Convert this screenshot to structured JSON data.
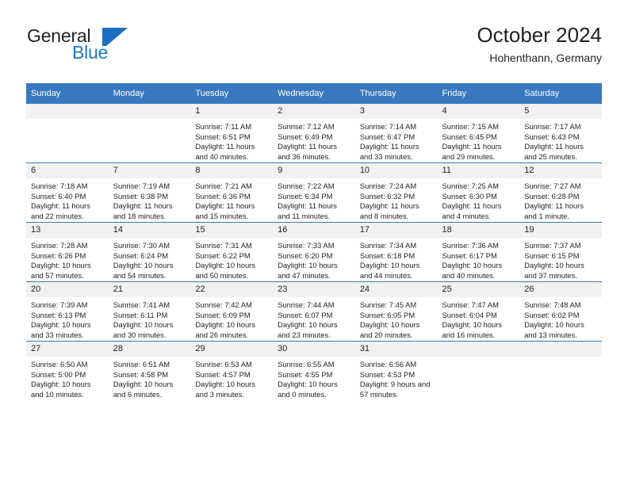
{
  "logo": {
    "text_primary": "General",
    "text_secondary": "Blue",
    "icon": "flag-triangle-icon",
    "color_primary": "#231f20",
    "color_secondary": "#1f77c2"
  },
  "header": {
    "title": "October 2024",
    "subtitle": "Hohenthann, Germany"
  },
  "colors": {
    "header_row_bg": "#3978bf",
    "daynum_bg": "#f1f1f1",
    "grid_line": "#3978bf",
    "text": "#231f20"
  },
  "weekday_headers": [
    "Sunday",
    "Monday",
    "Tuesday",
    "Wednesday",
    "Thursday",
    "Friday",
    "Saturday"
  ],
  "weeks": [
    [
      {
        "day": "",
        "empty": true
      },
      {
        "day": "",
        "empty": true
      },
      {
        "day": "1",
        "sunrise": "Sunrise: 7:11 AM",
        "sunset": "Sunset: 6:51 PM",
        "daylight": "Daylight: 11 hours and 40 minutes."
      },
      {
        "day": "2",
        "sunrise": "Sunrise: 7:12 AM",
        "sunset": "Sunset: 6:49 PM",
        "daylight": "Daylight: 11 hours and 36 minutes."
      },
      {
        "day": "3",
        "sunrise": "Sunrise: 7:14 AM",
        "sunset": "Sunset: 6:47 PM",
        "daylight": "Daylight: 11 hours and 33 minutes."
      },
      {
        "day": "4",
        "sunrise": "Sunrise: 7:15 AM",
        "sunset": "Sunset: 6:45 PM",
        "daylight": "Daylight: 11 hours and 29 minutes."
      },
      {
        "day": "5",
        "sunrise": "Sunrise: 7:17 AM",
        "sunset": "Sunset: 6:43 PM",
        "daylight": "Daylight: 11 hours and 25 minutes."
      }
    ],
    [
      {
        "day": "6",
        "sunrise": "Sunrise: 7:18 AM",
        "sunset": "Sunset: 6:40 PM",
        "daylight": "Daylight: 11 hours and 22 minutes."
      },
      {
        "day": "7",
        "sunrise": "Sunrise: 7:19 AM",
        "sunset": "Sunset: 6:38 PM",
        "daylight": "Daylight: 11 hours and 18 minutes."
      },
      {
        "day": "8",
        "sunrise": "Sunrise: 7:21 AM",
        "sunset": "Sunset: 6:36 PM",
        "daylight": "Daylight: 11 hours and 15 minutes."
      },
      {
        "day": "9",
        "sunrise": "Sunrise: 7:22 AM",
        "sunset": "Sunset: 6:34 PM",
        "daylight": "Daylight: 11 hours and 11 minutes."
      },
      {
        "day": "10",
        "sunrise": "Sunrise: 7:24 AM",
        "sunset": "Sunset: 6:32 PM",
        "daylight": "Daylight: 11 hours and 8 minutes."
      },
      {
        "day": "11",
        "sunrise": "Sunrise: 7:25 AM",
        "sunset": "Sunset: 6:30 PM",
        "daylight": "Daylight: 11 hours and 4 minutes."
      },
      {
        "day": "12",
        "sunrise": "Sunrise: 7:27 AM",
        "sunset": "Sunset: 6:28 PM",
        "daylight": "Daylight: 11 hours and 1 minute."
      }
    ],
    [
      {
        "day": "13",
        "sunrise": "Sunrise: 7:28 AM",
        "sunset": "Sunset: 6:26 PM",
        "daylight": "Daylight: 10 hours and 57 minutes."
      },
      {
        "day": "14",
        "sunrise": "Sunrise: 7:30 AM",
        "sunset": "Sunset: 6:24 PM",
        "daylight": "Daylight: 10 hours and 54 minutes."
      },
      {
        "day": "15",
        "sunrise": "Sunrise: 7:31 AM",
        "sunset": "Sunset: 6:22 PM",
        "daylight": "Daylight: 10 hours and 50 minutes."
      },
      {
        "day": "16",
        "sunrise": "Sunrise: 7:33 AM",
        "sunset": "Sunset: 6:20 PM",
        "daylight": "Daylight: 10 hours and 47 minutes."
      },
      {
        "day": "17",
        "sunrise": "Sunrise: 7:34 AM",
        "sunset": "Sunset: 6:18 PM",
        "daylight": "Daylight: 10 hours and 44 minutes."
      },
      {
        "day": "18",
        "sunrise": "Sunrise: 7:36 AM",
        "sunset": "Sunset: 6:17 PM",
        "daylight": "Daylight: 10 hours and 40 minutes."
      },
      {
        "day": "19",
        "sunrise": "Sunrise: 7:37 AM",
        "sunset": "Sunset: 6:15 PM",
        "daylight": "Daylight: 10 hours and 37 minutes."
      }
    ],
    [
      {
        "day": "20",
        "sunrise": "Sunrise: 7:39 AM",
        "sunset": "Sunset: 6:13 PM",
        "daylight": "Daylight: 10 hours and 33 minutes."
      },
      {
        "day": "21",
        "sunrise": "Sunrise: 7:41 AM",
        "sunset": "Sunset: 6:11 PM",
        "daylight": "Daylight: 10 hours and 30 minutes."
      },
      {
        "day": "22",
        "sunrise": "Sunrise: 7:42 AM",
        "sunset": "Sunset: 6:09 PM",
        "daylight": "Daylight: 10 hours and 26 minutes."
      },
      {
        "day": "23",
        "sunrise": "Sunrise: 7:44 AM",
        "sunset": "Sunset: 6:07 PM",
        "daylight": "Daylight: 10 hours and 23 minutes."
      },
      {
        "day": "24",
        "sunrise": "Sunrise: 7:45 AM",
        "sunset": "Sunset: 6:05 PM",
        "daylight": "Daylight: 10 hours and 20 minutes."
      },
      {
        "day": "25",
        "sunrise": "Sunrise: 7:47 AM",
        "sunset": "Sunset: 6:04 PM",
        "daylight": "Daylight: 10 hours and 16 minutes."
      },
      {
        "day": "26",
        "sunrise": "Sunrise: 7:48 AM",
        "sunset": "Sunset: 6:02 PM",
        "daylight": "Daylight: 10 hours and 13 minutes."
      }
    ],
    [
      {
        "day": "27",
        "sunrise": "Sunrise: 6:50 AM",
        "sunset": "Sunset: 5:00 PM",
        "daylight": "Daylight: 10 hours and 10 minutes."
      },
      {
        "day": "28",
        "sunrise": "Sunrise: 6:51 AM",
        "sunset": "Sunset: 4:58 PM",
        "daylight": "Daylight: 10 hours and 6 minutes."
      },
      {
        "day": "29",
        "sunrise": "Sunrise: 6:53 AM",
        "sunset": "Sunset: 4:57 PM",
        "daylight": "Daylight: 10 hours and 3 minutes."
      },
      {
        "day": "30",
        "sunrise": "Sunrise: 6:55 AM",
        "sunset": "Sunset: 4:55 PM",
        "daylight": "Daylight: 10 hours and 0 minutes."
      },
      {
        "day": "31",
        "sunrise": "Sunrise: 6:56 AM",
        "sunset": "Sunset: 4:53 PM",
        "daylight": "Daylight: 9 hours and 57 minutes."
      },
      {
        "day": "",
        "empty": true
      },
      {
        "day": "",
        "empty": true
      }
    ]
  ]
}
